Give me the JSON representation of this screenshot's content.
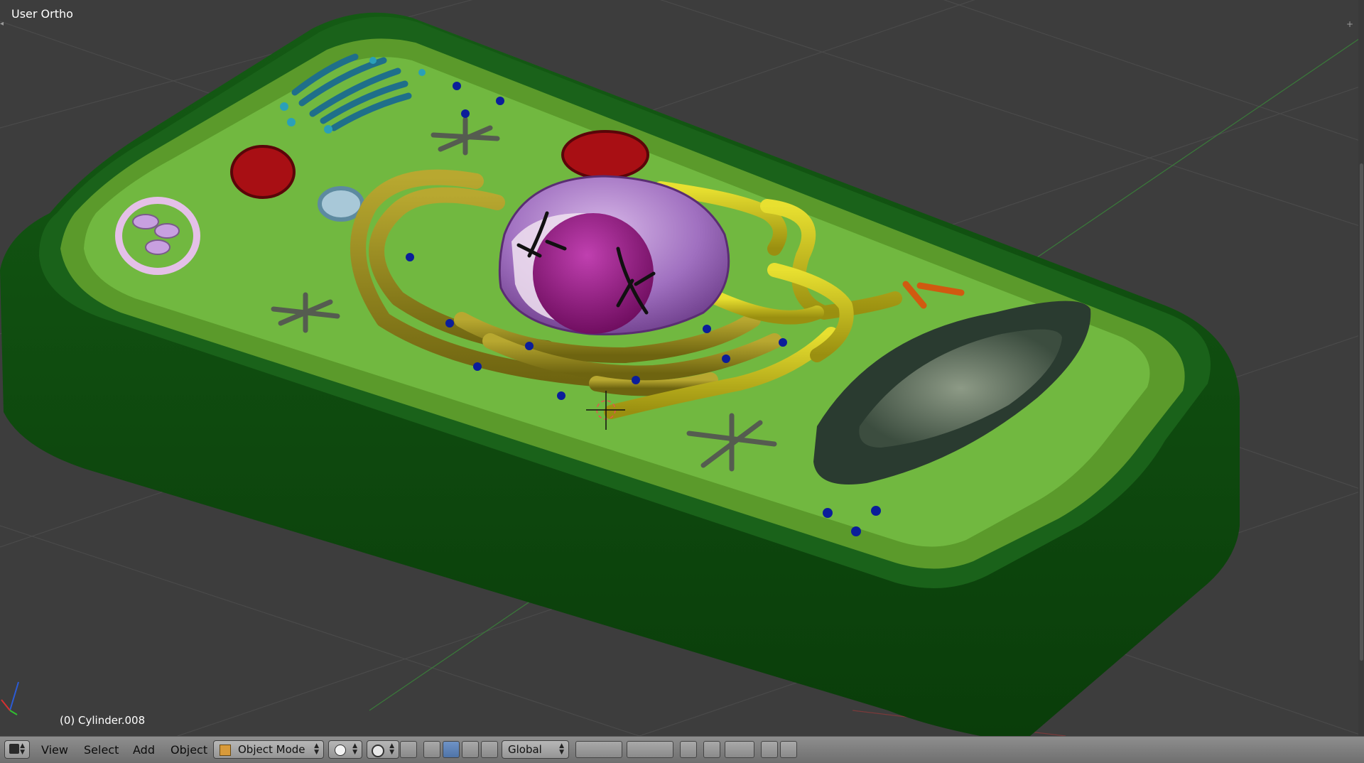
{
  "viewport": {
    "title": "User Ortho",
    "active_object": "(0) Cylinder.008"
  },
  "header": {
    "editor_type_icon": "3d-view-icon",
    "menus": [
      "View",
      "Select",
      "Add",
      "Object"
    ],
    "mode": "Object Mode",
    "viewport_shading_icon": "solid-sphere-icon",
    "pivot_icon": "pivot-point-icon",
    "transform_orientation": "Global"
  },
  "colors": {
    "background": "#3d3d3d",
    "grid_line": "#4a4a4a",
    "cell_wall": "#0f4d0f",
    "cell_membrane": "#5b9a2b",
    "cytoplasm": "#70b840",
    "er": "#9a8c18",
    "nucleus": "#9b63b8",
    "nucleolus": "#8b1a7a",
    "mitochondria": "#a80f14",
    "vacuole": "#2d4a37",
    "header_bg": "#7f7f7f"
  }
}
